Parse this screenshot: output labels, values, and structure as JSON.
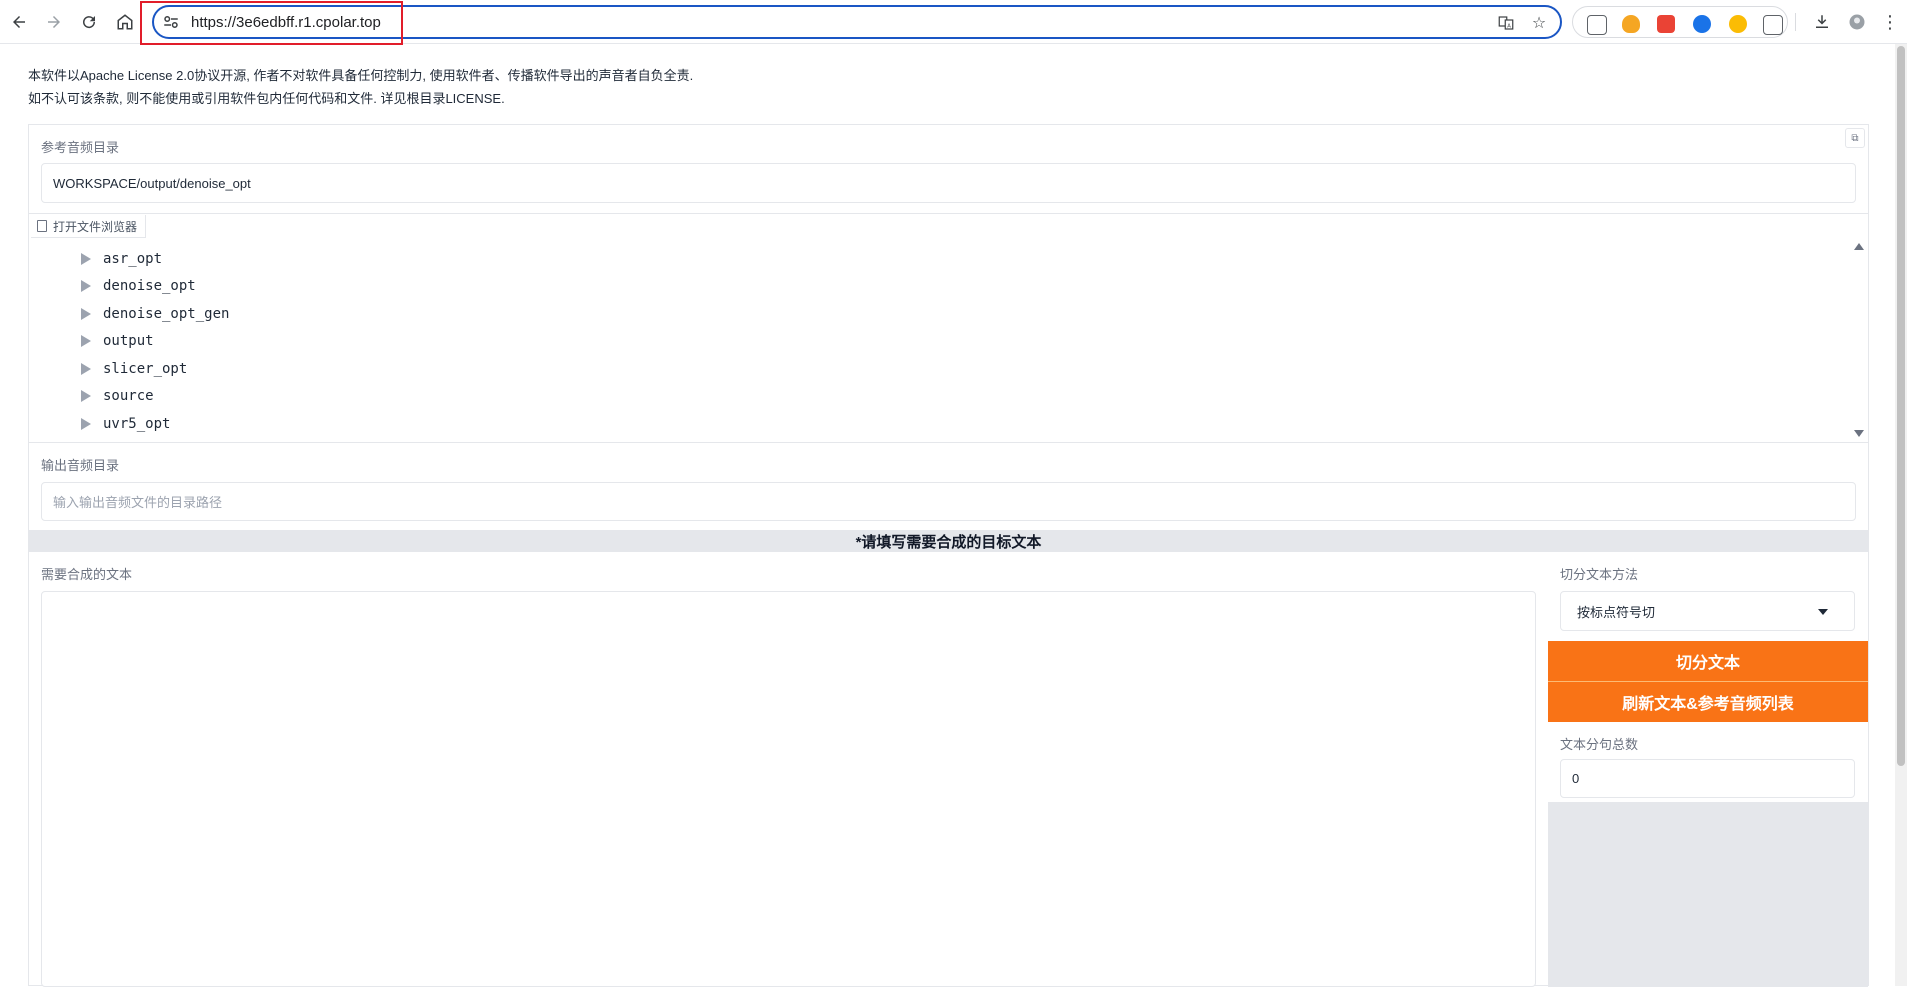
{
  "browser": {
    "url": "https://3e6edbff.r1.cpolar.top"
  },
  "page": {
    "license_line1": "本软件以Apache License 2.0协议开源, 作者不对软件具备任何控制力, 使用软件者、传播软件导出的声音者自负全责.",
    "license_line2": "如不认可该条款, 则不能使用或引用软件包内任何代码和文件. 详见根目录LICENSE."
  },
  "ref_audio": {
    "label": "参考音频目录",
    "value": "WORKSPACE/output/denoise_opt",
    "file_browser_tab": "打开文件浏览器",
    "folders": [
      "asr_opt",
      "denoise_opt",
      "denoise_opt_gen",
      "output",
      "slicer_opt",
      "source",
      "uvr5_opt"
    ]
  },
  "output_audio": {
    "label": "输出音频目录",
    "placeholder": "输入输出音频文件的目录路径"
  },
  "target_section": {
    "header": "*请填写需要合成的目标文本",
    "text_label": "需要合成的文本",
    "text_value": ""
  },
  "split": {
    "method_label": "切分文本方法",
    "method_value": "按标点符号切",
    "split_button": "切分文本",
    "refresh_button": "刷新文本&参考音频列表",
    "count_label": "文本分句总数",
    "count_value": "0"
  },
  "colors": {
    "accent_orange": "#f97316",
    "omnibox_border": "#1a56c4",
    "highlight_red": "#e11d2a"
  },
  "icons": {
    "back": "arrow-left-icon",
    "forward": "arrow-right-icon",
    "reload": "reload-icon",
    "home": "home-icon",
    "site_info": "tune-icon",
    "translate": "translate-icon",
    "bookmark": "star-icon",
    "download": "download-icon",
    "profile": "avatar-icon",
    "menu": "kebab-menu-icon"
  }
}
